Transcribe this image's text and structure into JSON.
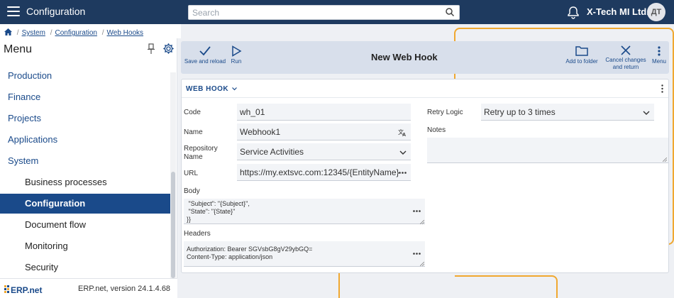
{
  "topbar": {
    "title": "Configuration",
    "search_placeholder": "Search",
    "company": "X-Tech MI Ltd.",
    "avatar_initials": "ДТ",
    "bg_color": "#1e3a5f"
  },
  "breadcrumb": [
    "System",
    "Configuration",
    "Web Hooks"
  ],
  "sidebar": {
    "title": "Menu",
    "items": [
      {
        "label": "Production",
        "level": "top"
      },
      {
        "label": "Finance",
        "level": "top"
      },
      {
        "label": "Projects",
        "level": "top"
      },
      {
        "label": "Applications",
        "level": "top"
      },
      {
        "label": "System",
        "level": "top"
      },
      {
        "label": "Business processes",
        "level": "sub"
      },
      {
        "label": "Configuration",
        "level": "sub",
        "active": true
      },
      {
        "label": "Document flow",
        "level": "sub"
      },
      {
        "label": "Monitoring",
        "level": "sub"
      },
      {
        "label": "Security",
        "level": "sub"
      }
    ],
    "footer_version": "ERP.net, version 24.1.4.68",
    "logo_text": "ERP.net"
  },
  "toolbar": {
    "save_label": "Save and reload",
    "run_label": "Run",
    "form_title": "New Web Hook",
    "add_folder_label": "Add to folder",
    "cancel_label_1": "Cancel changes",
    "cancel_label_2": "and return",
    "menu_label": "Menu"
  },
  "panel": {
    "title": "WEB HOOK",
    "code_label": "Code",
    "code_value": "wh_01",
    "name_label": "Name",
    "name_value": "Webhook1",
    "repo_label_1": "Repository",
    "repo_label_2": "Name",
    "repo_value": "Service Activities",
    "url_label": "URL",
    "url_value": "https://my.extsvc.com:12345/{EntityName}",
    "body_label": "Body",
    "body_value": " \"Subject\": \"{Subject}\",\n \"State\": \"{State}\"\n}}",
    "headers_label": "Headers",
    "headers_value": "Authorization: Bearer SGVsbG8gV29ybGQ=\nContent-Type: application/json",
    "retry_label": "Retry Logic",
    "retry_value": "Retry up to 3 times",
    "notes_label": "Notes",
    "notes_value": ""
  },
  "colors": {
    "accent": "#1a4a8a",
    "toolbar_bg": "#d8dfeb",
    "canvas_line": "#f0a830"
  }
}
